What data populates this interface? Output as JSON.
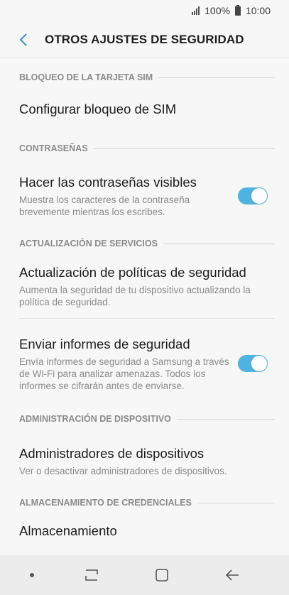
{
  "status": {
    "battery_text": "100%",
    "time": "10:00"
  },
  "header": {
    "title": "OTROS AJUSTES DE SEGURIDAD"
  },
  "sections": {
    "sim": {
      "label": "BLOQUEO DE LA TARJETA SIM",
      "item_title": "Configurar bloqueo de SIM"
    },
    "passwords": {
      "label": "CONTRASEÑAS",
      "item_title": "Hacer las contraseñas visibles",
      "item_desc": "Muestra los caracteres de la contraseña brevemente mientras los escribes.",
      "toggle_on": true
    },
    "services": {
      "label": "ACTUALIZACIÓN DE SERVICIOS",
      "item1_title": "Actualización de políticas de seguridad",
      "item1_desc": "Aumenta la seguridad de tu dispositivo actualizando la política de seguridad.",
      "item2_title": "Enviar informes de seguridad",
      "item2_desc": "Envía informes de seguridad a Samsung a través de Wi-Fi para analizar amenazas. Todos los informes se cifrarán antes de enviarse.",
      "item2_toggle_on": true
    },
    "device_admin": {
      "label": "ADMINISTRACIÓN DE DISPOSITIVO",
      "item_title": "Administradores de dispositivos",
      "item_desc": "Ver o desactivar administradores de dispositivos."
    },
    "credentials": {
      "label": "ALMACENAMIENTO DE CREDENCIALES",
      "item_title": "Almacenamiento"
    }
  },
  "colors": {
    "accent": "#4fb3e0",
    "back_arrow": "#3a8fc0"
  }
}
